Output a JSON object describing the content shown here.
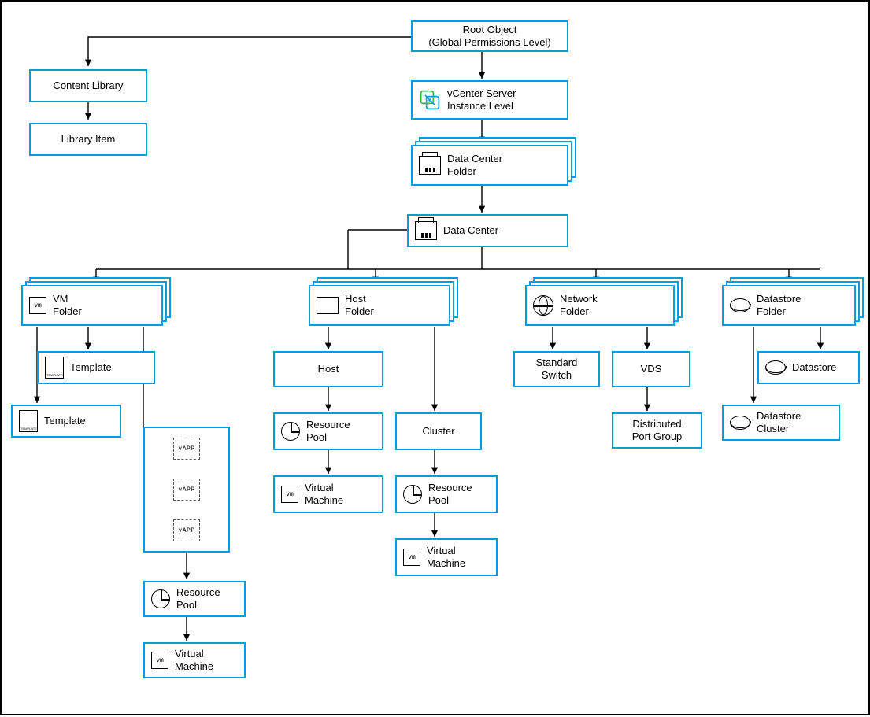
{
  "nodes": {
    "root": "Root Object\n(Global Permissions Level)",
    "content_library": "Content Library",
    "library_item": "Library Item",
    "vcenter": "vCenter Server\nInstance Level",
    "dc_folder": "Data Center\nFolder",
    "data_center": "Data Center",
    "vm_folder": "VM\nFolder",
    "template_inner": "Template",
    "template_outer": "Template",
    "vapp": "vAPP",
    "vm_res_pool": "Resource\nPool",
    "vm_vm": "Virtual\nMachine",
    "host_folder": "Host\nFolder",
    "host": "Host",
    "host_res_pool": "Resource\nPool",
    "host_vm": "Virtual\nMachine",
    "cluster": "Cluster",
    "cluster_res_pool": "Resource\nPool",
    "cluster_vm": "Virtual\nMachine",
    "network_folder": "Network\nFolder",
    "std_switch": "Standard\nSwitch",
    "vds": "VDS",
    "dpg": "Distributed\nPort Group",
    "ds_folder": "Datastore\nFolder",
    "datastore": "Datastore",
    "ds_cluster": "Datastore\nCluster"
  }
}
